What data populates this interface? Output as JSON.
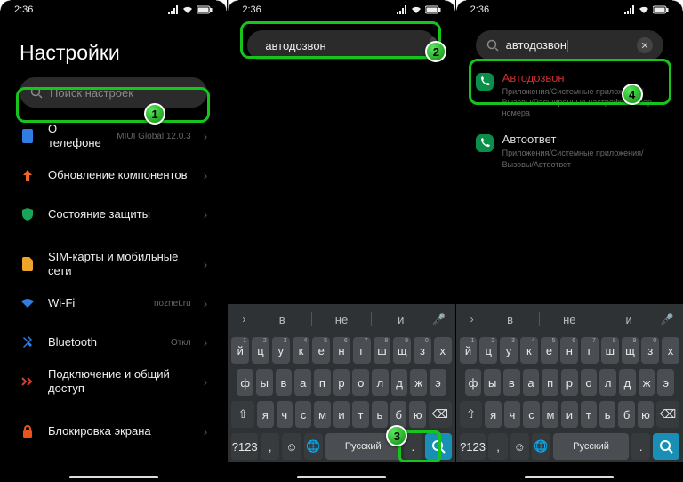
{
  "status": {
    "time": "2:36"
  },
  "screen1": {
    "title": "Настройки",
    "search_placeholder": "Поиск настроек",
    "rows": [
      {
        "label": "О телефоне",
        "sub": "MIUI Global 12.0.3",
        "icon": "phone-info",
        "color": "#2f7de1"
      },
      {
        "label": "Обновление компонентов",
        "icon": "arrow-up",
        "color": "#f0662a"
      },
      {
        "label": "Состояние защиты",
        "icon": "shield",
        "color": "#18a558"
      },
      {
        "label": "SIM-карты и мобильные сети",
        "icon": "sim",
        "color": "#f0a52a"
      },
      {
        "label": "Wi-Fi",
        "sub": "noznet.ru",
        "icon": "wifi",
        "color": "#2f7de1"
      },
      {
        "label": "Bluetooth",
        "sub": "Откл",
        "icon": "bluetooth",
        "color": "#2f7de1"
      },
      {
        "label": "Подключение и общий доступ",
        "icon": "share",
        "color": "#d1402a"
      },
      {
        "label": "Блокировка экрана",
        "icon": "lock",
        "color": "#e8531f"
      }
    ]
  },
  "screen2": {
    "search_value": "автодозвон",
    "keyboard": {
      "suggestions": [
        "в",
        "не",
        "и"
      ],
      "row1": [
        "й",
        "ц",
        "у",
        "к",
        "е",
        "н",
        "г",
        "ш",
        "щ",
        "з",
        "х"
      ],
      "row1nums": [
        "1",
        "2",
        "3",
        "4",
        "5",
        "6",
        "7",
        "8",
        "9",
        "0",
        ""
      ],
      "row2": [
        "ф",
        "ы",
        "в",
        "а",
        "п",
        "р",
        "о",
        "л",
        "д",
        "ж",
        "э"
      ],
      "row3_shift": "⇧",
      "row3": [
        "я",
        "ч",
        "с",
        "м",
        "и",
        "т",
        "ь",
        "б",
        "ю"
      ],
      "row3_back": "⌫",
      "row4_sym": "?123",
      "row4_comma": ",",
      "row4_emoji": "☺",
      "row4_globe": "🌐",
      "row4_space": "Русский",
      "row4_dot": "."
    }
  },
  "screen3": {
    "search_value": "автодозвон",
    "results": [
      {
        "title": "Автодозвон",
        "red": true,
        "path": "Приложения/Системные приложения/Вызовы/Расширенные настройки/Набор номера"
      },
      {
        "title": "Автоответ",
        "red": false,
        "path": "Приложения/Системные приложения/Вызовы/Автоответ"
      }
    ]
  },
  "annotations": {
    "n1": "1",
    "n2": "2",
    "n3": "3",
    "n4": "4"
  }
}
